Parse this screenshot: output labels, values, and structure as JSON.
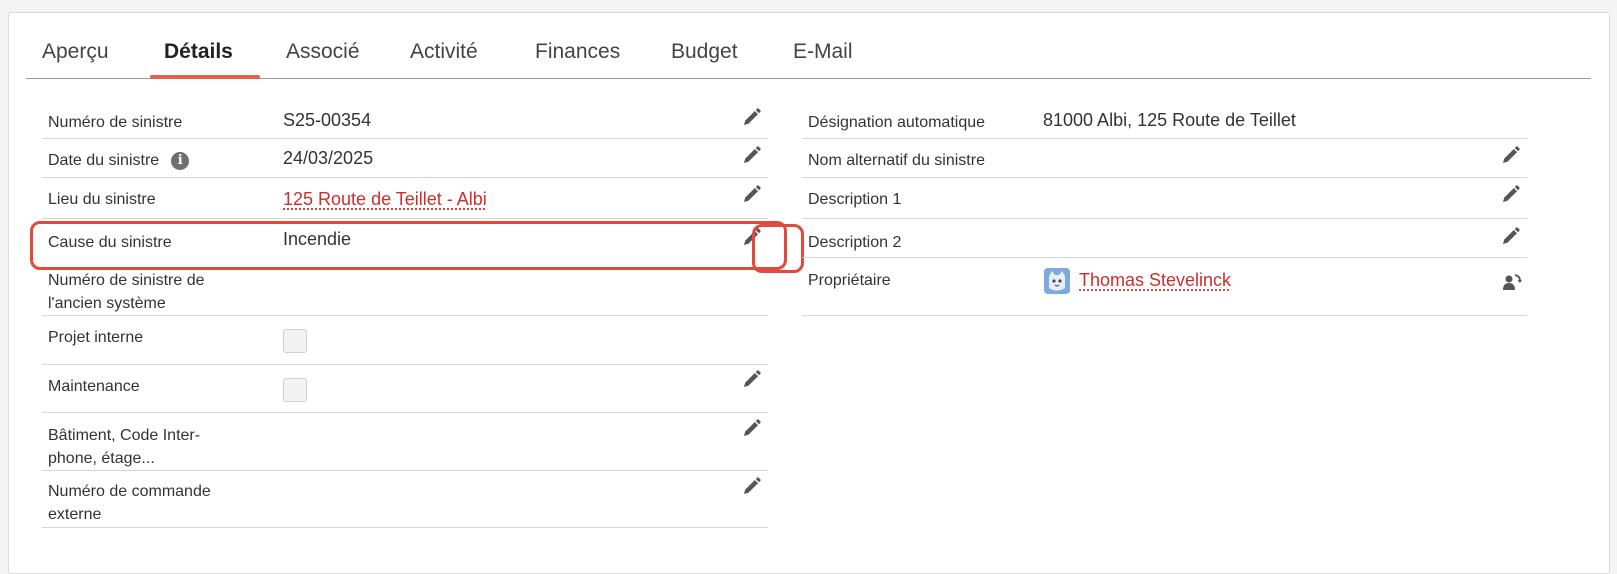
{
  "tabs": [
    "Aperçu",
    "Détails",
    "Associé",
    "Activité",
    "Finances",
    "Budget",
    "E-Mail"
  ],
  "active_tab": "Détails",
  "left_fields": {
    "numero_sinistre": {
      "label": "Numéro de sinistre",
      "value": "S25-00354"
    },
    "date_sinistre": {
      "label": "Date du sinistre",
      "info_icon": "i",
      "value": "24/03/2025"
    },
    "lieu_sinistre": {
      "label": "Lieu du sinistre",
      "value": "125 Route de Teillet - Albi"
    },
    "cause_sinistre": {
      "label": "Cause du sinistre",
      "value": "Incendie"
    },
    "ancien_numero": {
      "label_line1": "Numéro de sinistre de",
      "label_line2": "l'ancien système"
    },
    "projet_interne": {
      "label": "Projet interne",
      "checked": false
    },
    "maintenance": {
      "label": "Maintenance",
      "checked": false
    },
    "batiment": {
      "label_line1": "Bâtiment, Code Inter-",
      "label_line2": "phone, étage..."
    },
    "commande_externe": {
      "label_line1": "Numéro de commande",
      "label_line2": "externe"
    }
  },
  "right_fields": {
    "designation": {
      "label": "Désignation automatique",
      "value": "81000 Albi, 125 Route de Teillet"
    },
    "nom_alternatif": {
      "label": "Nom alternatif du sinistre"
    },
    "description1": {
      "label": "Description 1"
    },
    "description2": {
      "label": "Description 2"
    },
    "proprietaire": {
      "label": "Propriétaire",
      "value": "Thomas Stevelinck"
    }
  },
  "icons": {
    "edit": "pencil-icon",
    "info": "info-icon",
    "reassign": "user-reassign-icon",
    "avatar": "user-avatar"
  },
  "colors": {
    "accent": "#e8604c",
    "link": "#c9302c",
    "highlight": "#e04a3a"
  }
}
